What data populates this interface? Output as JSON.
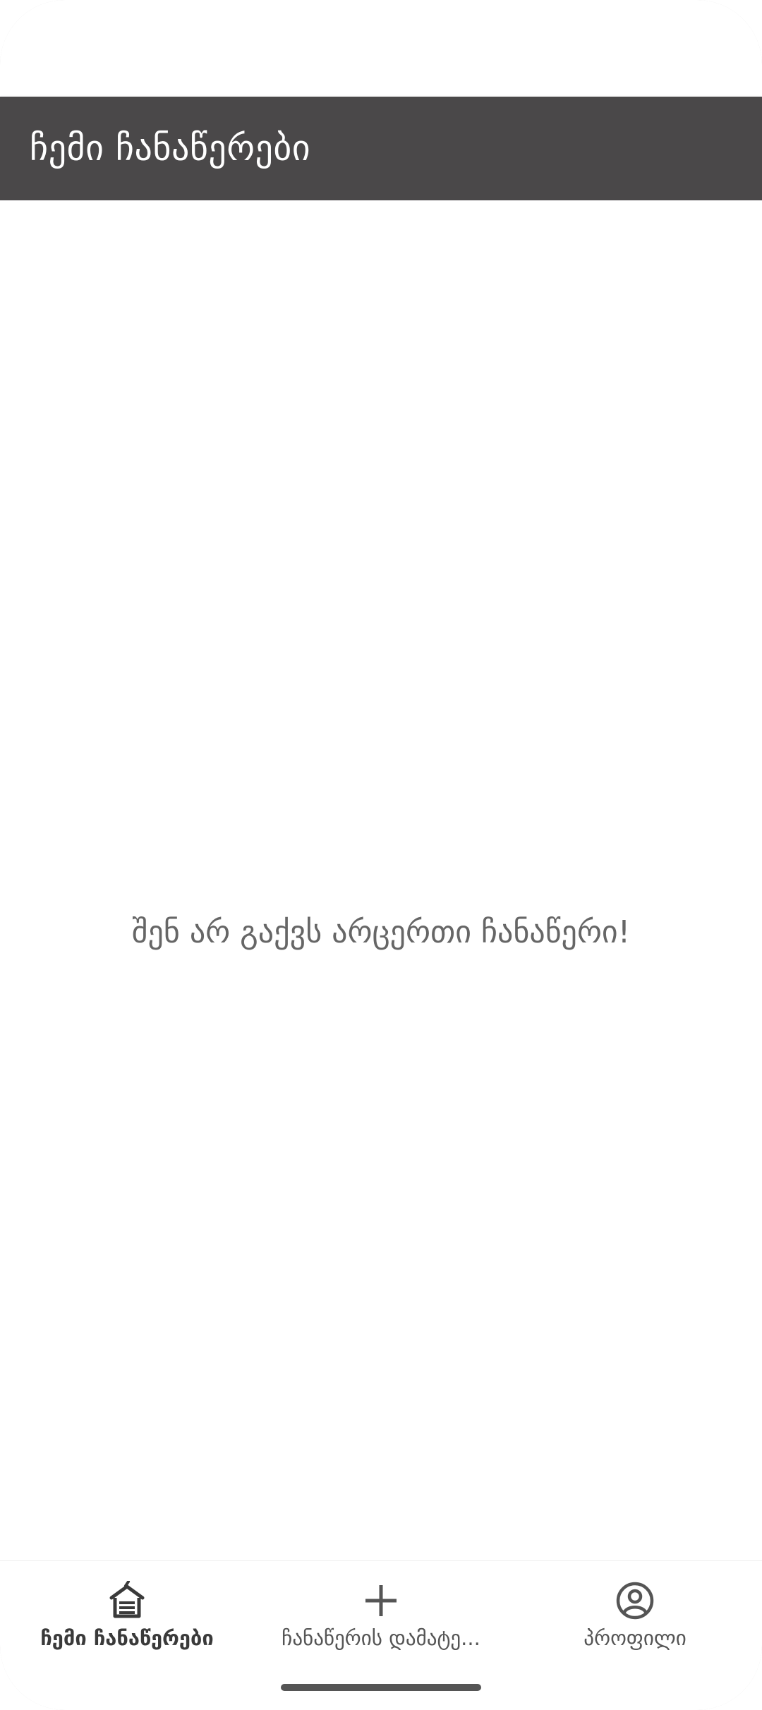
{
  "app_bar": {
    "title": "ჩემი ჩანაწერები"
  },
  "main": {
    "empty_message": "შენ არ გაქვს არცერთი ჩანაწერი!"
  },
  "bottom_nav": {
    "items": [
      {
        "label": "ჩემი ჩანაწერები",
        "icon": "home-icon",
        "active": true
      },
      {
        "label": "ჩანაწერის დამატე...",
        "icon": "plus-icon",
        "active": false
      },
      {
        "label": "პროფილი",
        "icon": "account-circle-icon",
        "active": false
      }
    ]
  },
  "colors": {
    "app_bar_bg": "#4a4849",
    "text_muted": "#666666"
  }
}
